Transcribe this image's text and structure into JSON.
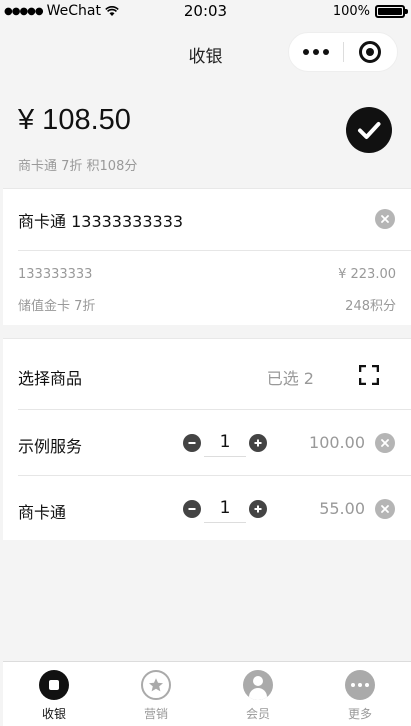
{
  "status_bar": {
    "carrier": "WeChat",
    "time": "20:03",
    "battery": "100%"
  },
  "navbar": {
    "title": "收银"
  },
  "summary": {
    "amount": "¥ 108.50",
    "subtitle": "商卡通 7折 积108分"
  },
  "member": {
    "name": "商卡通 13333333333",
    "phone": "133333333",
    "balance": "¥ 223.00",
    "card_type": "储值金卡 7折",
    "points": "248积分"
  },
  "goods": {
    "header_label": "选择商品",
    "selected_text": "已选 2",
    "items": [
      {
        "name": "示例服务",
        "qty": "1",
        "price": "100.00"
      },
      {
        "name": "商卡通",
        "qty": "1",
        "price": "55.00"
      }
    ]
  },
  "tabbar": {
    "tabs": [
      {
        "label": "收银",
        "icon": "stop-circle-icon",
        "active": true
      },
      {
        "label": "营销",
        "icon": "star-icon",
        "active": false
      },
      {
        "label": "会员",
        "icon": "user-icon",
        "active": false
      },
      {
        "label": "更多",
        "icon": "more-icon",
        "active": false
      }
    ]
  },
  "colors": {
    "primary": "#111111",
    "muted": "#999999",
    "background": "#f4f4f4"
  }
}
